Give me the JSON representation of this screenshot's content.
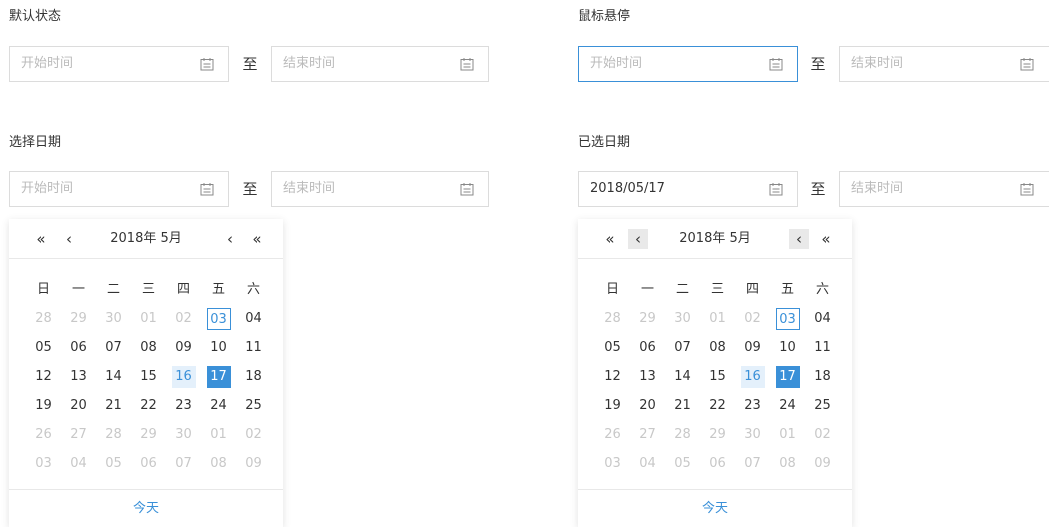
{
  "sections": [
    {
      "title": "默认状态",
      "start": {
        "text": "开始时间",
        "filled": false
      },
      "end": {
        "text": "结束时间",
        "filled": false
      }
    },
    {
      "title": "鼠标悬停",
      "start": {
        "text": "开始时间",
        "filled": false
      },
      "end": {
        "text": "结束时间",
        "filled": false
      }
    },
    {
      "title": "选择日期",
      "start": {
        "text": "开始时间",
        "filled": false
      },
      "end": {
        "text": "结束时间",
        "filled": false
      }
    },
    {
      "title": "已选日期",
      "start": {
        "text": "2018/05/17",
        "filled": true
      },
      "end": {
        "text": "结束时间",
        "filled": false
      }
    }
  ],
  "separator": "至",
  "icons": {
    "calendar": "calendar-icon"
  },
  "colors": {
    "accent": "#3a90d8",
    "range_bg": "#e4f0fb",
    "border": "#dcdcdc",
    "muted": "#c8c8c8"
  },
  "picker": {
    "title": "2018年 5月",
    "nav": {
      "prev_year": "«",
      "prev_month": "‹",
      "next_month": "‹",
      "next_year": "«"
    },
    "weekdays": [
      "日",
      "一",
      "二",
      "三",
      "四",
      "五",
      "六"
    ],
    "weeks": [
      [
        {
          "d": "28",
          "s": "muted"
        },
        {
          "d": "29",
          "s": "muted"
        },
        {
          "d": "30",
          "s": "muted"
        },
        {
          "d": "01",
          "s": "muted"
        },
        {
          "d": "02",
          "s": "muted"
        },
        {
          "d": "03",
          "s": "today"
        },
        {
          "d": "04",
          "s": ""
        }
      ],
      [
        {
          "d": "05",
          "s": ""
        },
        {
          "d": "06",
          "s": ""
        },
        {
          "d": "07",
          "s": ""
        },
        {
          "d": "08",
          "s": ""
        },
        {
          "d": "09",
          "s": ""
        },
        {
          "d": "10",
          "s": ""
        },
        {
          "d": "11",
          "s": ""
        }
      ],
      [
        {
          "d": "12",
          "s": ""
        },
        {
          "d": "13",
          "s": ""
        },
        {
          "d": "14",
          "s": ""
        },
        {
          "d": "15",
          "s": ""
        },
        {
          "d": "16",
          "s": "range"
        },
        {
          "d": "17",
          "s": "selected"
        },
        {
          "d": "18",
          "s": ""
        }
      ],
      [
        {
          "d": "19",
          "s": ""
        },
        {
          "d": "20",
          "s": ""
        },
        {
          "d": "21",
          "s": ""
        },
        {
          "d": "22",
          "s": ""
        },
        {
          "d": "23",
          "s": ""
        },
        {
          "d": "24",
          "s": ""
        },
        {
          "d": "25",
          "s": ""
        }
      ],
      [
        {
          "d": "26",
          "s": "muted"
        },
        {
          "d": "27",
          "s": "muted"
        },
        {
          "d": "28",
          "s": "muted"
        },
        {
          "d": "29",
          "s": "muted"
        },
        {
          "d": "30",
          "s": "muted"
        },
        {
          "d": "01",
          "s": "muted"
        },
        {
          "d": "02",
          "s": "muted"
        }
      ],
      [
        {
          "d": "03",
          "s": "muted"
        },
        {
          "d": "04",
          "s": "muted"
        },
        {
          "d": "05",
          "s": "muted"
        },
        {
          "d": "06",
          "s": "muted"
        },
        {
          "d": "07",
          "s": "muted"
        },
        {
          "d": "08",
          "s": "muted"
        },
        {
          "d": "09",
          "s": "muted"
        }
      ]
    ],
    "today_label": "今天"
  }
}
